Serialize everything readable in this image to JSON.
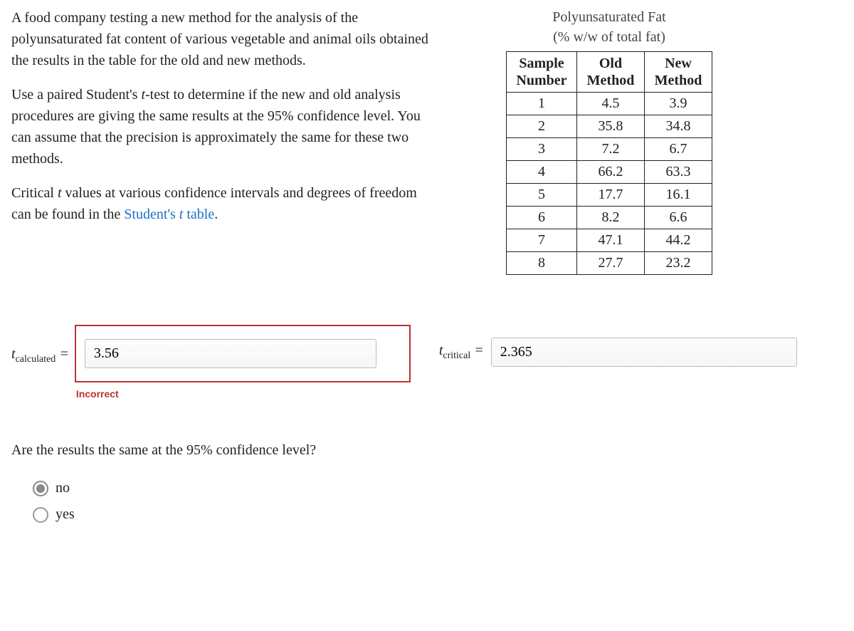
{
  "problem": {
    "para1_prefix": "A food company testing a new method for the analysis of the polyunsaturated fat content of various vegetable and animal oils obtained the results in the table for the old and new methods.",
    "para2_a": "Use a paired Student's ",
    "para2_b": "-test to determine if the new and old analysis procedures are giving the same results at the 95% confidence level. You can assume that the precision is approximately the same for these two methods.",
    "para3_a": "Critical ",
    "para3_b": " values at various confidence intervals and degrees of freedom can be found in the ",
    "link_text": "Student's t table",
    "para3_c": "."
  },
  "table": {
    "title_line1": "Polyunsaturated Fat",
    "title_line2": "(% w/w of total fat)",
    "headers": {
      "c1": "Sample Number",
      "c2": "Old Method",
      "c3": "New Method"
    },
    "rows": [
      {
        "n": "1",
        "old": "4.5",
        "new": "3.9"
      },
      {
        "n": "2",
        "old": "35.8",
        "new": "34.8"
      },
      {
        "n": "3",
        "old": "7.2",
        "new": "6.7"
      },
      {
        "n": "4",
        "old": "66.2",
        "new": "63.3"
      },
      {
        "n": "5",
        "old": "17.7",
        "new": "16.1"
      },
      {
        "n": "6",
        "old": "8.2",
        "new": "6.6"
      },
      {
        "n": "7",
        "old": "47.1",
        "new": "44.2"
      },
      {
        "n": "8",
        "old": "27.7",
        "new": "23.2"
      }
    ]
  },
  "answers": {
    "t_calc_label_t": "t",
    "t_calc_label_sub": "calculated",
    "t_calc_value": "3.56",
    "t_calc_feedback": "Incorrect",
    "t_crit_label_t": "t",
    "t_crit_label_sub": "critical",
    "t_crit_value": "2.365",
    "equals": " ="
  },
  "question": {
    "text": "Are the results the same at the 95% confidence level?",
    "opt_no": "no",
    "opt_yes": "yes"
  }
}
